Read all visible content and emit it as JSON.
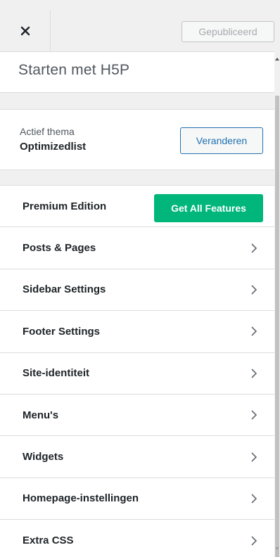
{
  "header": {
    "publish_label": "Gepubliceerd"
  },
  "title": "Starten met H5P",
  "theme": {
    "label": "Actief thema",
    "name": "Optimizedlist",
    "change_label": "Veranderen"
  },
  "menu": {
    "premium_label": "Premium Edition",
    "features_label": "Get All Features",
    "items": [
      {
        "label": "Posts & Pages"
      },
      {
        "label": "Sidebar Settings"
      },
      {
        "label": "Footer Settings"
      },
      {
        "label": "Site-identiteit"
      },
      {
        "label": "Menu's"
      },
      {
        "label": "Widgets"
      },
      {
        "label": "Homepage-instellingen"
      },
      {
        "label": "Extra CSS"
      }
    ]
  },
  "colors": {
    "accent": "#2271b1",
    "features_button": "#00b67a"
  },
  "icons": {
    "close": "close-icon",
    "chevron": "chevron-right-icon"
  }
}
